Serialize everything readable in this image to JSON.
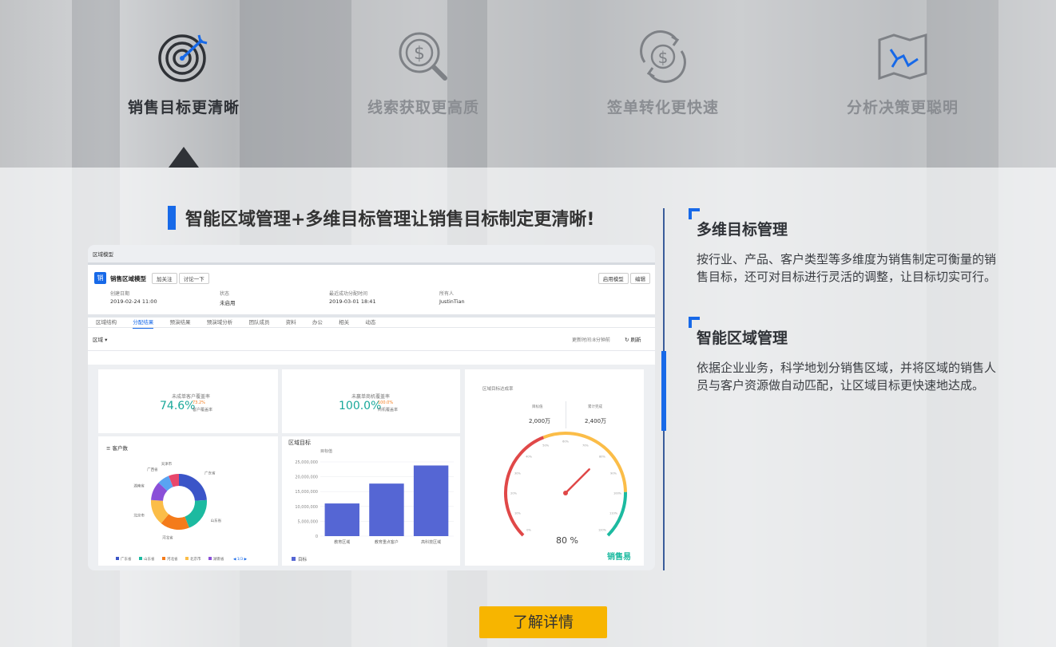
{
  "features": [
    {
      "label": "销售目标更清晰",
      "icon": "target-icon",
      "active": true
    },
    {
      "label": "线索获取更高质",
      "icon": "dollar-search-icon",
      "active": false
    },
    {
      "label": "签单转化更快速",
      "icon": "dollar-cycle-icon",
      "active": false
    },
    {
      "label": "分析决策更聪明",
      "icon": "map-chart-icon",
      "active": false
    }
  ],
  "headline": "智能区域管理+多维目标管理让销售目标制定更清晰!",
  "sections": [
    {
      "title": "多维目标管理",
      "body": "按行业、产品、客户类型等多维度为销售制定可衡量的销售目标，还可对目标进行灵活的调整，让目标切实可行。"
    },
    {
      "title": "智能区域管理",
      "body": "依据企业业务，科学地划分销售区域，并将区域的销售人员与客户资源做自动匹配，让区域目标更快速地达成。"
    }
  ],
  "cta": "了解详情",
  "colors": {
    "accent": "#1769e8",
    "cta": "#f7b500"
  },
  "screenshot": {
    "breadcrumb": "区域模型",
    "app_icon": "销",
    "title": "销售区域模型",
    "follow_btn": "加关注",
    "discuss_btn": "讨论一下",
    "enable_btn": "启用模型",
    "edit_btn": "编辑",
    "meta": [
      {
        "label": "创建日期",
        "value": "2019-02-24 11:00"
      },
      {
        "label": "状态",
        "value": "未启用"
      },
      {
        "label": "最近成功分配时间",
        "value": "2019-03-01 18:41"
      },
      {
        "label": "所有人",
        "value": "JustinTian"
      }
    ],
    "tabs": [
      "区域结构",
      "分配结果",
      "预演结果",
      "预演域分析",
      "团队成员",
      "资料",
      "办公",
      "相关",
      "动态"
    ],
    "filter": "区域",
    "update_time": "更新时间:8分钟前",
    "refresh": "刷新",
    "kpi1": {
      "label": "未成单客户覆盖率",
      "value": "74.6%",
      "delta": "73.2%",
      "sub": "客户覆盖率"
    },
    "kpi2": {
      "label": "未赢单商机覆盖率",
      "value": "100.0%",
      "delta": "100.0%",
      "sub": "商机覆盖率"
    },
    "donut": {
      "title": "客户数",
      "slices": [
        {
          "name": "广东省",
          "value": 24,
          "color": "#3b55c8"
        },
        {
          "name": "山东省",
          "value": 20,
          "color": "#1cbaa0"
        },
        {
          "name": "河北省",
          "value": 17,
          "color": "#f47b1a"
        },
        {
          "name": "北京市",
          "value": 15,
          "color": "#fbbd48"
        },
        {
          "name": "湖南省",
          "value": 11,
          "color": "#8a4fd8"
        },
        {
          "name": "广西省",
          "value": 7,
          "color": "#59a3f2"
        },
        {
          "name": "天津市",
          "value": 6,
          "color": "#e8476b"
        }
      ],
      "legend": [
        "广东省",
        "山东省",
        "河北省",
        "北京市",
        "湖南省"
      ],
      "pager": "1/3"
    },
    "bars": {
      "title": "区域目标",
      "series": "目标值",
      "ticks": [
        "25,000,000",
        "20,000,000",
        "15,000,000",
        "10,000,000",
        "5,000,000",
        "0"
      ],
      "categories": [
        "教育区域",
        "教育重点客户",
        "高科技区域"
      ],
      "values": [
        11000000,
        17700000,
        23800000
      ],
      "legend": "目标",
      "max": 25000000
    },
    "gauge": {
      "title": "区域目标达成率",
      "left_label": "目标值",
      "left_value": "2,000万",
      "right_label": "累计完成",
      "right_value": "2,400万",
      "value": "80 %",
      "ticks": [
        "0%",
        "10%",
        "20%",
        "30%",
        "40%",
        "50%",
        "60%",
        "70%",
        "80%",
        "90%",
        "100%",
        "110%",
        "120%"
      ],
      "percent": 0.8
    },
    "brand": "销售易"
  }
}
